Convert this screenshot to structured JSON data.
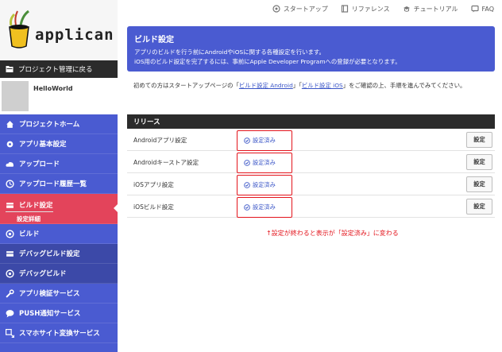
{
  "topbar": {
    "links": [
      {
        "label": "スタートアップ",
        "icon": "gear-person-icon"
      },
      {
        "label": "リファレンス",
        "icon": "book-icon"
      },
      {
        "label": "チュートリアル",
        "icon": "tutorial-icon"
      },
      {
        "label": "FAQ",
        "icon": "faq-icon"
      }
    ]
  },
  "logo": {
    "text": "applican"
  },
  "sidebar": {
    "back_label": "プロジェクト管理に戻る",
    "project_name": "HelloWorld",
    "items": [
      {
        "label": "プロジェクトホーム",
        "icon": "home-icon"
      },
      {
        "label": "アプリ基本設定",
        "icon": "settings-icon"
      },
      {
        "label": "アップロード",
        "icon": "cloud-upload-icon"
      },
      {
        "label": "アップロード履歴一覧",
        "icon": "history-icon"
      },
      {
        "label": "ビルド設定",
        "icon": "build-settings-icon",
        "sub": "設定詳細"
      },
      {
        "label": "ビルド",
        "icon": "build-icon"
      },
      {
        "label": "デバッグビルド設定",
        "icon": "debug-settings-icon"
      },
      {
        "label": "デバッグビルド",
        "icon": "debug-build-icon"
      },
      {
        "label": "アプリ検証サービス",
        "icon": "wrench-icon"
      },
      {
        "label": "PUSH通知サービス",
        "icon": "chat-icon"
      },
      {
        "label": "スマホサイト変換サービス",
        "icon": "convert-icon"
      }
    ]
  },
  "header": {
    "title": "ビルド設定",
    "line1": "アプリのビルドを行う前にAndroidやiOSに関する各種設定を行います。",
    "line2": "iOS用のビルド設定を完了するには、事前にApple Developer Programへの登録が必要となります。"
  },
  "intro": {
    "pre": "初めての方はスタートアップページの「",
    "link1": "ビルド設定 Android",
    "mid": "」「",
    "link2": "ビルド設定 iOS",
    "post": "」をご確認の上、手順を進んでみてください。"
  },
  "release": {
    "title": "リリース",
    "rows": [
      {
        "label": "Androidアプリ設定",
        "status": "設定済み",
        "button": "設定"
      },
      {
        "label": "Androidキーストア設定",
        "status": "設定済み",
        "button": "設定"
      },
      {
        "label": "iOSアプリ設定",
        "status": "設定済み",
        "button": "設定"
      },
      {
        "label": "iOSビルド設定",
        "status": "設定済み",
        "button": "設定"
      }
    ]
  },
  "annotation": "↑設定が終わると表示が「設定済み」に変わる",
  "colors": {
    "sidebar": "#4a5bd1",
    "active": "#e3445b",
    "dark": "#2b2b2b",
    "highlight": "#e3141c"
  }
}
